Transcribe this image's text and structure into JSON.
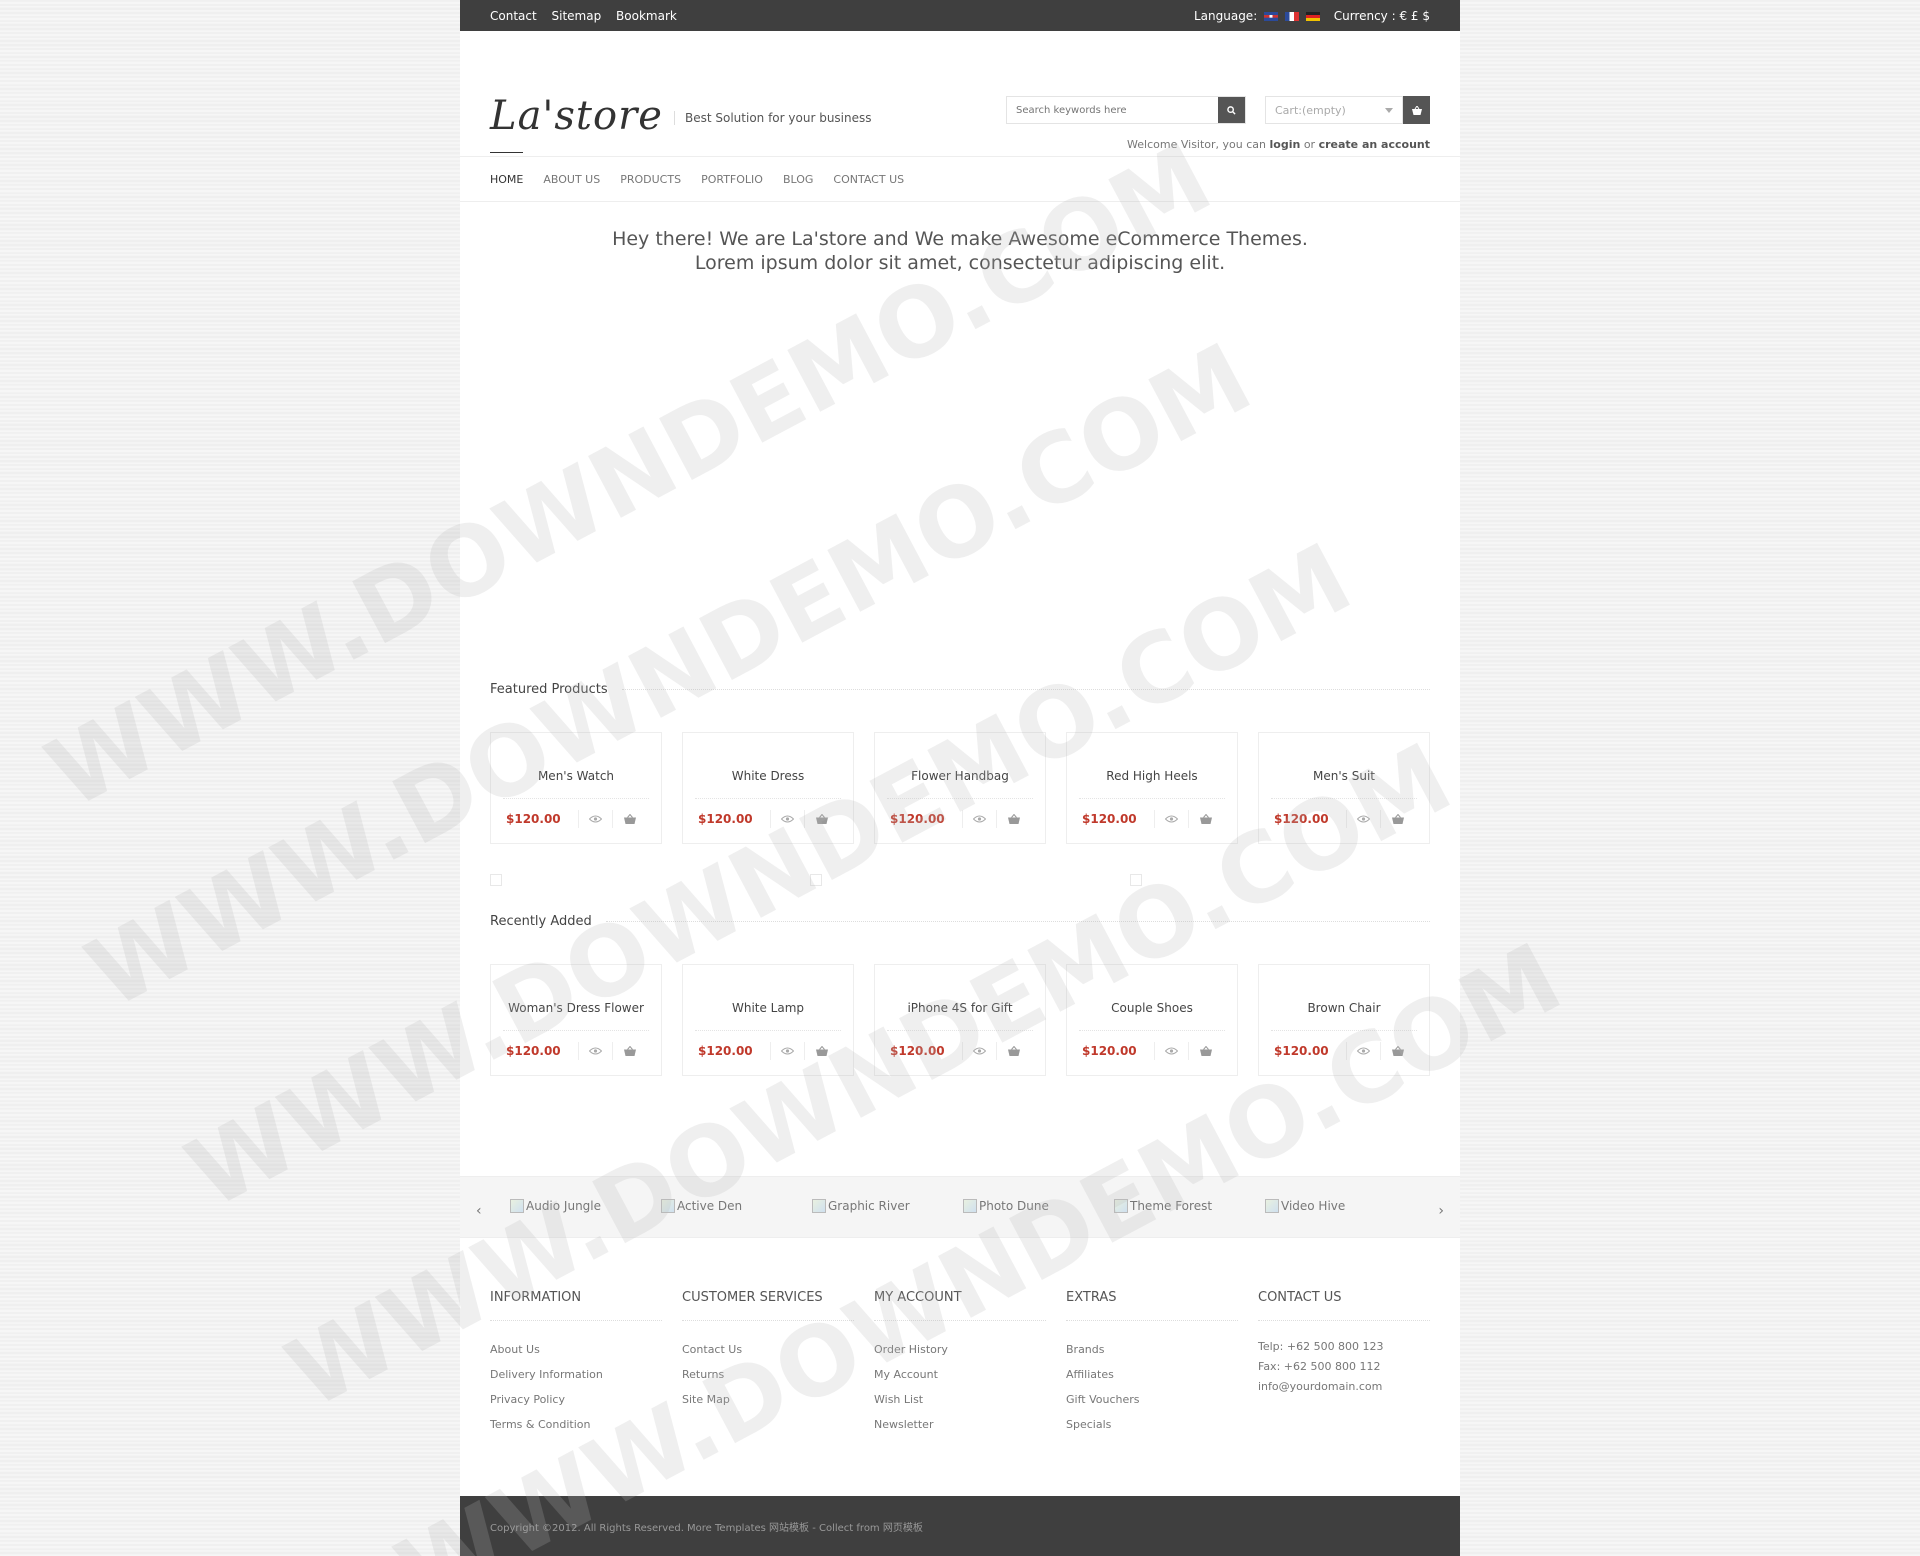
{
  "topbar": {
    "links": [
      "Contact",
      "Sitemap",
      "Bookmark"
    ],
    "language_label": "Language:",
    "currency_label": "Currency : € £ $"
  },
  "header": {
    "logo": "La'store",
    "tagline": "Best Solution for your business",
    "search_placeholder": "Search keywords here",
    "cart_label": "Cart:(empty)",
    "welcome_text": "Welcome Visitor, you can",
    "login": "login",
    "or": "or",
    "create_account": "create an account"
  },
  "nav": [
    "HOME",
    "ABOUT US",
    "PRODUCTS",
    "PORTFOLIO",
    "BLOG",
    "CONTACT US"
  ],
  "hero": {
    "line1": "Hey there! We are La'store and We make Awesome eCommerce Themes.",
    "line2": "Lorem ipsum dolor sit amet, consectetur adipiscing elit."
  },
  "featured": {
    "title": "Featured Products",
    "products": [
      {
        "name": "Men's Watch",
        "price": "$120.00"
      },
      {
        "name": "White Dress",
        "price": "$120.00"
      },
      {
        "name": "Flower Handbag",
        "price": "$120.00"
      },
      {
        "name": "Red High Heels",
        "price": "$120.00"
      },
      {
        "name": "Men's Suit",
        "price": "$120.00"
      }
    ]
  },
  "recent": {
    "title": "Recently Added",
    "products": [
      {
        "name": "Woman's Dress Flower",
        "price": "$120.00"
      },
      {
        "name": "White Lamp",
        "price": "$120.00"
      },
      {
        "name": "iPhone 4S for Gift",
        "price": "$120.00"
      },
      {
        "name": "Couple Shoes",
        "price": "$120.00"
      },
      {
        "name": "Brown Chair",
        "price": "$120.00"
      }
    ]
  },
  "brands": [
    "Audio Jungle",
    "Active Den",
    "Graphic River",
    "Photo Dune",
    "Theme Forest",
    "Video Hive"
  ],
  "footer": {
    "information": {
      "title": "INFORMATION",
      "items": [
        "About Us",
        "Delivery Information",
        "Privacy Policy",
        "Terms & Condition"
      ]
    },
    "customer": {
      "title": "CUSTOMER SERVICES",
      "items": [
        "Contact Us",
        "Returns",
        "Site Map"
      ]
    },
    "account": {
      "title": "MY ACCOUNT",
      "items": [
        "Order History",
        "My Account",
        "Wish List",
        "Newsletter"
      ]
    },
    "extras": {
      "title": "EXTRAS",
      "items": [
        "Brands",
        "Affiliates",
        "Gift Vouchers",
        "Specials"
      ]
    },
    "contact": {
      "title": "CONTACT US",
      "items": [
        "Telp: +62 500 800 123",
        "Fax: +62 500 800 112",
        "info@yourdomain.com"
      ]
    }
  },
  "copyright": "Copyright ©2012. All Rights Reserved. More Templates 网站模板 - Collect from 网页模板",
  "watermark": "WWW.DOWNDEMO.COM",
  "colors": {
    "price": "#c0392b",
    "topbar": "#3f3f3f"
  }
}
